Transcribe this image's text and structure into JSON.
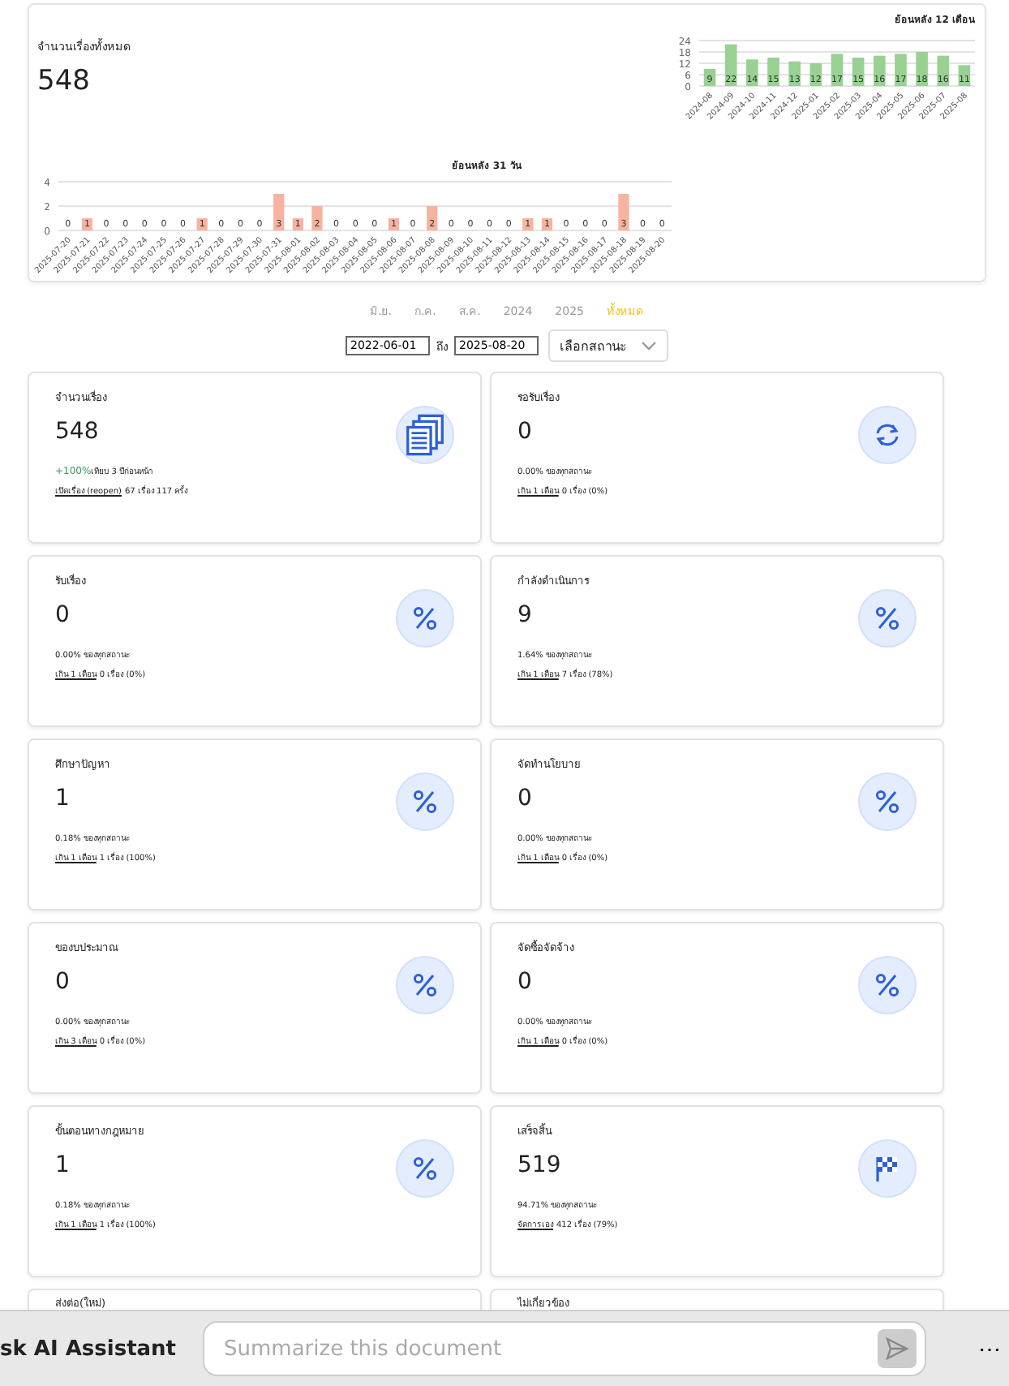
{
  "summary": {
    "title": "จำนวนเรื่องทั้งหมด",
    "value": "548",
    "monthly": {
      "chart_data": {
        "type": "bar",
        "title": "ย้อนหลัง 12 เดือน",
        "categories": [
          "2024-08",
          "2024-09",
          "2024-10",
          "2024-11",
          "2024-12",
          "2025-01",
          "2025-02",
          "2025-03",
          "2025-04",
          "2025-05",
          "2025-06",
          "2025-07",
          "2025-08"
        ],
        "series": [
          {
            "color": "#98d191",
            "values": [
              9,
              22,
              14,
              15,
              13,
              12,
              17,
              15,
              16,
              17,
              18,
              16,
              11
            ]
          }
        ],
        "ylim": [
          0,
          24
        ],
        "yticks": [
          0,
          6,
          12,
          18,
          24
        ],
        "grid": true,
        "data_labels": true
      }
    },
    "daily": {
      "chart_data": {
        "type": "bar",
        "title": "ย้อนหลัง 31 วัน",
        "categories": [
          "2025-07-20",
          "2025-07-21",
          "2025-07-22",
          "2025-07-23",
          "2025-07-24",
          "2025-07-25",
          "2025-07-26",
          "2025-07-27",
          "2025-07-28",
          "2025-07-29",
          "2025-07-30",
          "2025-07-31",
          "2025-08-01",
          "2025-08-02",
          "2025-08-03",
          "2025-08-04",
          "2025-08-05",
          "2025-08-06",
          "2025-08-07",
          "2025-08-08",
          "2025-08-09",
          "2025-08-10",
          "2025-08-11",
          "2025-08-12",
          "2025-08-13",
          "2025-08-14",
          "2025-08-15",
          "2025-08-16",
          "2025-08-17",
          "2025-08-18",
          "2025-08-19",
          "2025-08-20"
        ],
        "series": [
          {
            "color": "#f5b3a0",
            "values": [
              0,
              1,
              0,
              0,
              0,
              0,
              0,
              1,
              0,
              0,
              0,
              3,
              1,
              2,
              0,
              0,
              0,
              1,
              0,
              2,
              0,
              0,
              0,
              0,
              1,
              1,
              0,
              0,
              0,
              3,
              0,
              0
            ]
          }
        ],
        "ylim": [
          0,
          4
        ],
        "yticks": [
          0,
          2,
          4
        ],
        "grid": true,
        "data_labels": true
      }
    }
  },
  "period_filters": [
    {
      "label": "มิ.ย.",
      "selected": false
    },
    {
      "label": "ก.ค.",
      "selected": false
    },
    {
      "label": "ส.ค.",
      "selected": false
    },
    {
      "label": "2024",
      "selected": false
    },
    {
      "label": "2025",
      "selected": false
    },
    {
      "label": "ทั้งหมด",
      "selected": true
    }
  ],
  "date_range": {
    "from": "2022-06-01",
    "separator": "ถึง",
    "to": "2025-08-20"
  },
  "status_select": {
    "placeholder": "เลือกสถานะ"
  },
  "cards": [
    {
      "kind": "total",
      "title": "จำนวนเรื่อง",
      "value": "548",
      "change": "+100%",
      "change_note": "เทียบ 3 ปีก่อนหน้า",
      "link": "เปิดเรื่อง (reopen)",
      "link_note": "67 เรื่อง 117 ครั้ง"
    },
    {
      "kind": "waiting",
      "title": "รอรับเรื่อง",
      "value": "0",
      "share": "0.00% ของทุกสถานะ",
      "link": "เกิน 1 เดือน",
      "link_note": "0 เรื่อง (0%)"
    },
    {
      "kind": "stage",
      "title": "รับเรื่อง",
      "value": "0",
      "share": "0.00% ของทุกสถานะ",
      "link": "เกิน 1 เดือน",
      "link_note": "0 เรื่อง (0%)"
    },
    {
      "kind": "stage",
      "title": "กำลังดำเนินการ",
      "value": "9",
      "share": "1.64% ของทุกสถานะ",
      "link": "เกิน 1 เดือน",
      "link_note": "7 เรื่อง (78%)"
    },
    {
      "kind": "stage",
      "title": "ศึกษาปัญหา",
      "value": "1",
      "share": "0.18% ของทุกสถานะ",
      "link": "เกิน 1 เดือน",
      "link_note": "1 เรื่อง (100%)"
    },
    {
      "kind": "stage",
      "title": "จัดทำนโยบาย",
      "value": "0",
      "share": "0.00% ของทุกสถานะ",
      "link": "เกิน 1 เดือน",
      "link_note": "0 เรื่อง (0%)"
    },
    {
      "kind": "stage",
      "title": "ของบประมาณ",
      "value": "0",
      "share": "0.00% ของทุกสถานะ",
      "link": "เกิน 3 เดือน",
      "link_note": "0 เรื่อง (0%)"
    },
    {
      "kind": "stage",
      "title": "จัดซื้อจัดจ้าง",
      "value": "0",
      "share": "0.00% ของทุกสถานะ",
      "link": "เกิน 1 เดือน",
      "link_note": "0 เรื่อง (0%)"
    },
    {
      "kind": "stage",
      "title": "ขั้นตอนทางกฎหมาย",
      "value": "1",
      "share": "0.18% ของทุกสถานะ",
      "link": "เกิน 1 เดือน",
      "link_note": "1 เรื่อง (100%)"
    },
    {
      "kind": "done",
      "title": "เสร็จสิ้น",
      "value": "519",
      "share": "94.71% ของทุกสถานะ",
      "link": "จัดการเอง",
      "link_note": "412 เรื่อง (79%)"
    },
    {
      "kind": "partial",
      "title": "ส่งต่อ(ใหม่)"
    },
    {
      "kind": "partial",
      "title": "ไม่เกี่ยวข้อง"
    }
  ],
  "assistant_bar": {
    "label": "sk AI Assistant",
    "placeholder": "Summarize this document",
    "more": "⋯"
  }
}
